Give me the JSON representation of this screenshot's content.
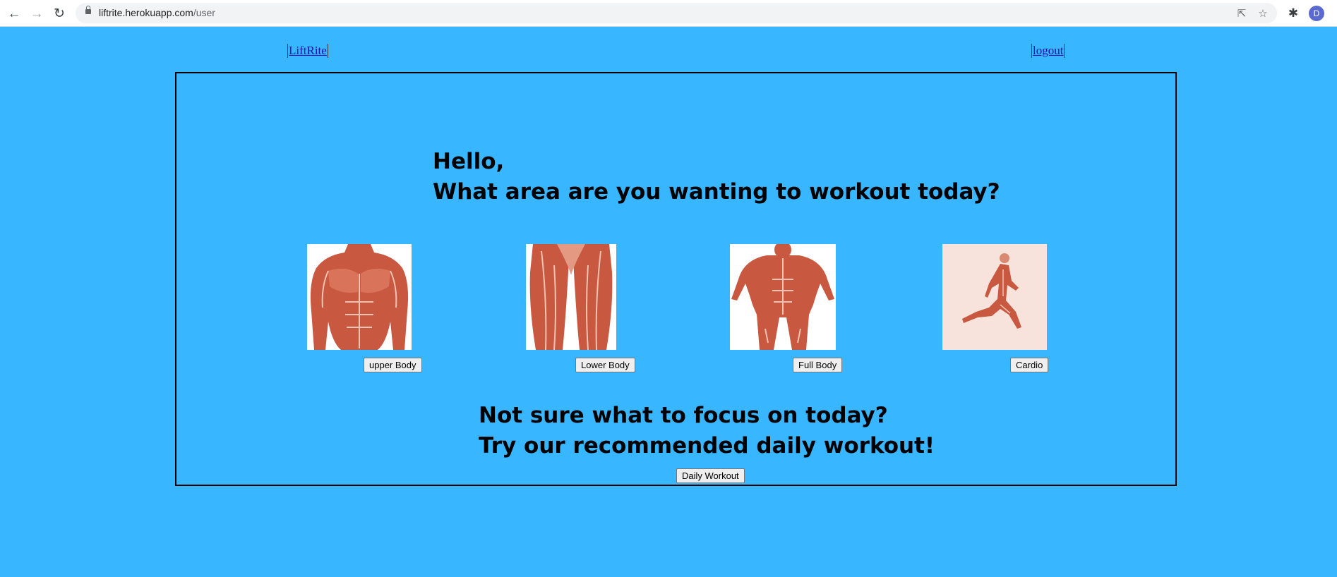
{
  "browser": {
    "url_host": "liftrite.herokuapp.com",
    "url_path": "/user",
    "profile_initial": "D"
  },
  "nav": {
    "brand_label": "LiftRite",
    "logout_label": "logout"
  },
  "main": {
    "greeting": "Hello,",
    "question": "What area are you wanting to workout today?",
    "categories": [
      {
        "label": "upper Body",
        "image": "upper-body-anatomy"
      },
      {
        "label": "Lower Body",
        "image": "lower-body-anatomy"
      },
      {
        "label": "Full Body",
        "image": "full-body-anatomy"
      },
      {
        "label": "Cardio",
        "image": "running-anatomy"
      }
    ],
    "unsure_line": "Not sure what to focus on today?",
    "recommend_line": "Try our recommended daily workout!",
    "daily_button": "Daily Workout"
  },
  "colors": {
    "page_background": "#38b6ff",
    "muscle": "#c8583f",
    "muscle_light": "#e49a82"
  }
}
